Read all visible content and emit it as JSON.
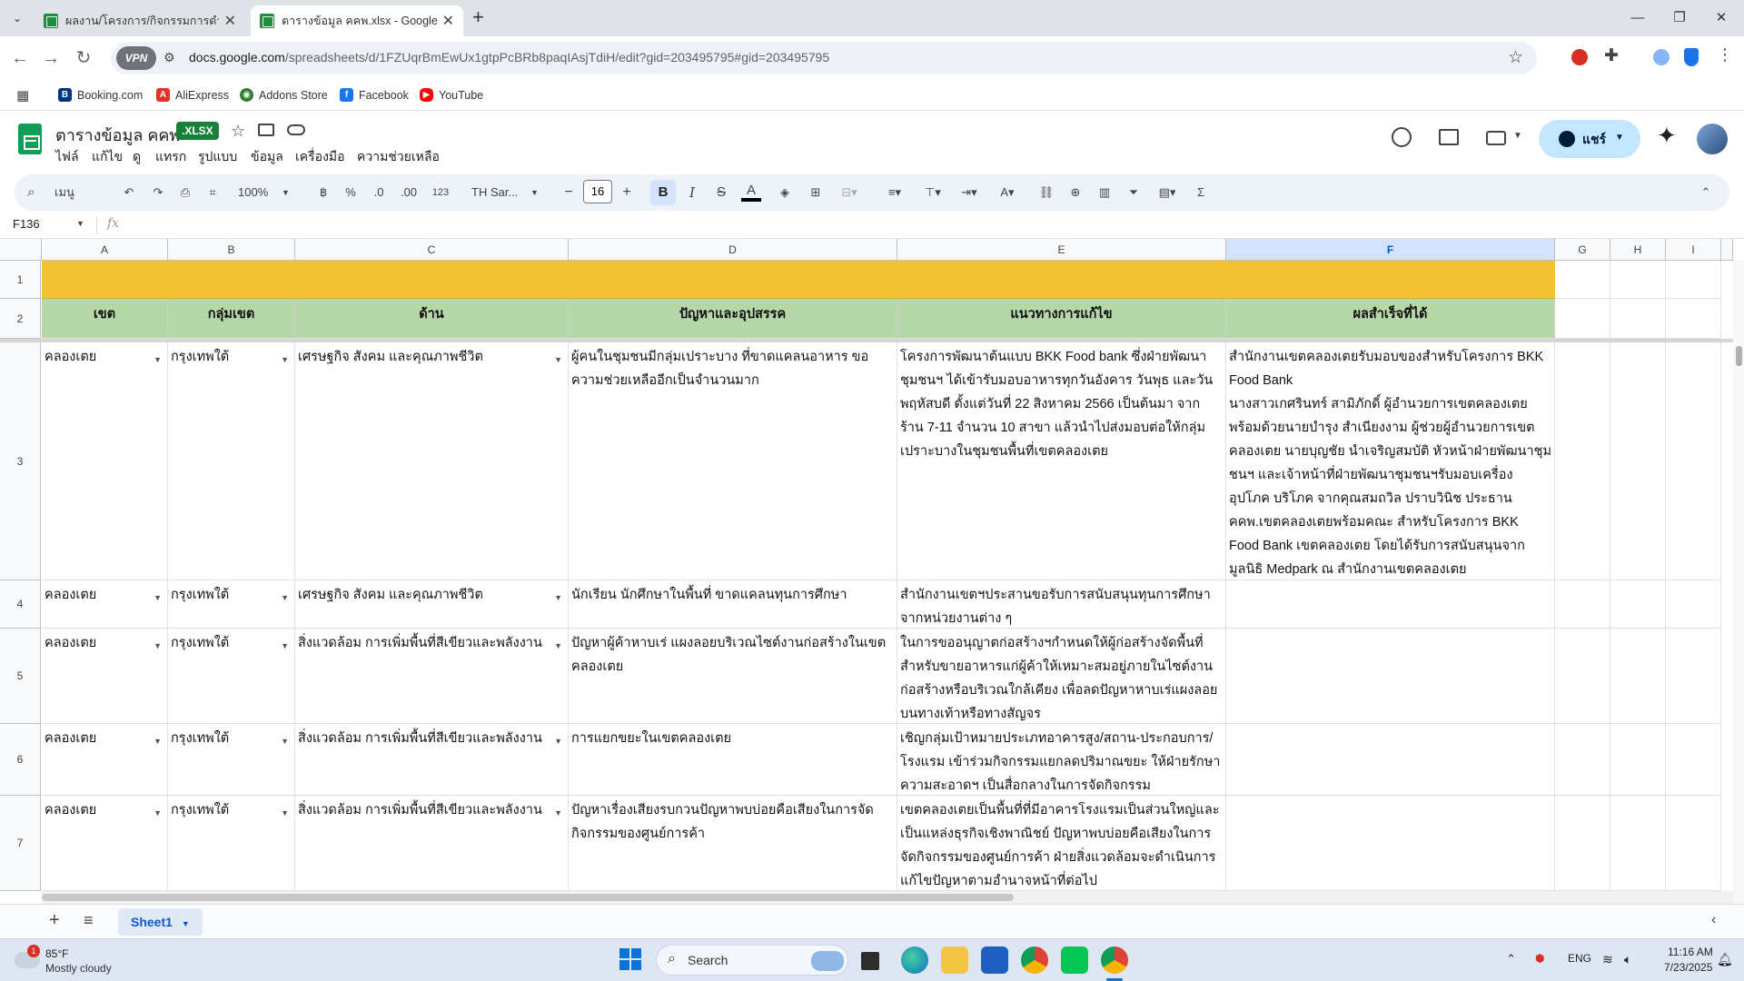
{
  "browser": {
    "tabs": [
      {
        "title": "ผลงาน/โครงการ/กิจกรรมการดำเนิน...",
        "active": false
      },
      {
        "title": "ตารางข้อมูล คคพ.xlsx - Google ชีต",
        "active": true
      }
    ],
    "new_tab": "+",
    "url_host": "docs.google.com",
    "url_path": "/spreadsheets/d/1FZUqrBmEwUx1gtpPcBRb8paqIAsjTdiH/edit?gid=203495795#gid=203495795",
    "vpn_label": "VPN",
    "bookmarks": [
      {
        "label": "Booking.com",
        "color": "#003580"
      },
      {
        "label": "AliExpress",
        "color": "#e43225"
      },
      {
        "label": "Addons Store",
        "color": "#2e7d32"
      },
      {
        "label": "Facebook",
        "color": "#1877f2"
      },
      {
        "label": "YouTube",
        "color": "#ff0000"
      }
    ]
  },
  "sheets": {
    "doc_title": "ตารางข้อมูล คคพ",
    "file_badge": ".XLSX",
    "menus": [
      "ไฟล์",
      "แก้ไข",
      "ดู",
      "แทรก",
      "รูปแบบ",
      "ข้อมูล",
      "เครื่องมือ",
      "ความช่วยเหลือ"
    ],
    "share_label": "แชร์",
    "toolbar": {
      "search_menu": "เมนู",
      "zoom": "100%",
      "currency": "฿",
      "percent": "%",
      "dec_decrease": ".0",
      "dec_increase": ".00",
      "number_format": "123",
      "font_name": "TH Sar...",
      "font_size": "16",
      "bold": "B",
      "italic": "I",
      "strike": "S",
      "text_color": "A"
    },
    "name_box": "F136",
    "fx": "fx",
    "columns": [
      "A",
      "B",
      "C",
      "D",
      "E",
      "F",
      "G",
      "H",
      "I"
    ],
    "selected_column": "F",
    "header_row": [
      "เขต",
      "กลุ่มเขต",
      "ด้าน",
      "ปัญหาและอุปสรรค",
      "แนวทางการแก้ไข",
      "ผลสำเร็จที่ได้"
    ],
    "rows": [
      {
        "num": "3",
        "cells": [
          "คลองเตย",
          "กรุงเทพใต้",
          "เศรษฐกิจ สังคม และคุณภาพชีวิต",
          "ผู้คนในชุมชนมีกลุ่มเปราะบาง ที่ขาดแคลนอาหาร ขอความช่วยเหลืออีกเป็นจำนวนมาก",
          "โครงการพัฒนาต้นแบบ BKK Food bank ซึ่งฝ่ายพัฒนาชุมชนฯ ได้เข้ารับมอบอาหารทุกวันอังคาร วันพุธ และวันพฤหัสบดี ตั้งแต่วันที่ 22 สิงหาคม 2566 เป็นต้นมา จากร้าน 7-11 จำนวน 10 สาขา แล้วนำไปส่งมอบต่อให้กลุ่มเปราะบางในชุมชนพื้นที่เขตคลองเตย",
          "สำนักงานเขตคลองเตยรับมอบของสำหรับโครงการ BKK Food Bank\nนางสาวเกศรินทร์ สามิภักดิ์ ผู้อำนวยการเขตคลองเตย พร้อมด้วยนายบำรุง สำเนียงงาม ผู้ช่วยผู้อำนวยการเขตคลองเตย นายบุญชัย นำเจริญสมบัติ หัวหน้าฝ่ายพัฒนาชุมชนฯ และเจ้าหน้าที่ฝ่ายพัฒนาชุมชนฯรับมอบเครื่องอุปโภค บริโภค จากคุณสมถวิล ปราบวินิช ประธานคคพ.เขตคลองเตยพร้อมคณะ สำหรับโครงการ BKK Food Bank เขตคลองเตย โดยได้รับการสนับสนุนจาก มูลนิธิ Medpark ณ สำนักงานเขตคลองเตย"
        ]
      },
      {
        "num": "4",
        "cells": [
          "คลองเตย",
          "กรุงเทพใต้",
          "เศรษฐกิจ สังคม และคุณภาพชีวิต",
          "นักเรียน นักศึกษาในพื้นที่ ขาดแคลนทุนการศึกษา",
          "สำนักงานเขตฯประสานขอรับการสนับสนุนทุนการศึกษาจากหน่วยงานต่าง ๆ",
          ""
        ]
      },
      {
        "num": "5",
        "cells": [
          "คลองเตย",
          "กรุงเทพใต้",
          "สิ่งแวดล้อม การเพิ่มพื้นที่สีเขียวและพลังงาน",
          "ปัญหาผู้ค้าหาบเร่ แผงลอยบริเวณไซต์งานก่อสร้างในเขตคลองเตย",
          "ในการขออนุญาตก่อสร้างฯกำหนดให้ผู้ก่อสร้างจัดพื้นที่สำหรับขายอาหารแก่ผู้ค้าให้เหมาะสมอยู่ภายในไซต์งานก่อสร้างหรือบริเวณใกล้เคียง เพื่อลดปัญหาหาบเร่แผงลอยบนทางเท้าหรือทางสัญจร",
          ""
        ]
      },
      {
        "num": "6",
        "cells": [
          "คลองเตย",
          "กรุงเทพใต้",
          "สิ่งแวดล้อม การเพิ่มพื้นที่สีเขียวและพลังงาน",
          "การแยกขยะในเขตคลองเตย",
          "เชิญกลุ่มเป้าหมายประเภทอาคารสูง/สถาน-ประกอบการ/โรงแรม เข้าร่วมกิจกรรมแยกลดปริมาณขยะ ให้ฝ่ายรักษาความสะอาดฯ เป็นสื่อกลางในการจัดกิจกรรม",
          ""
        ]
      },
      {
        "num": "7",
        "cells": [
          "คลองเตย",
          "กรุงเทพใต้",
          "สิ่งแวดล้อม การเพิ่มพื้นที่สีเขียวและพลังงาน",
          "ปัญหาเรื่องเสียงรบกวนปัญหาพบบ่อยคือเสียงในการจัดกิจกรรมของศูนย์การค้า",
          "เขตคลองเตยเป็นพื้นที่ที่มีอาคารโรงแรมเป็นส่วนใหญ่และเป็นแหล่งธุรกิจเชิงพาณิชย์ ปัญหาพบบ่อยคือเสียงในการจัดกิจกรรมของศูนย์การค้า ฝ่ายสิ่งแวดล้อมจะดำเนินการแก้ไขปัญหาตามอำนาจหน้าที่ต่อไป",
          ""
        ]
      }
    ],
    "row_labels_top": [
      "1",
      "2"
    ],
    "sheet_tab": "Sheet1",
    "row1_color": "#f1c232",
    "row2_color": "#b6d7a8"
  },
  "taskbar": {
    "weather_temp": "85°F",
    "weather_desc": "Mostly cloudy",
    "weather_badge": "1",
    "search_label": "Search",
    "lang": "ENG",
    "time": "11:16 AM",
    "date": "7/23/2025"
  }
}
